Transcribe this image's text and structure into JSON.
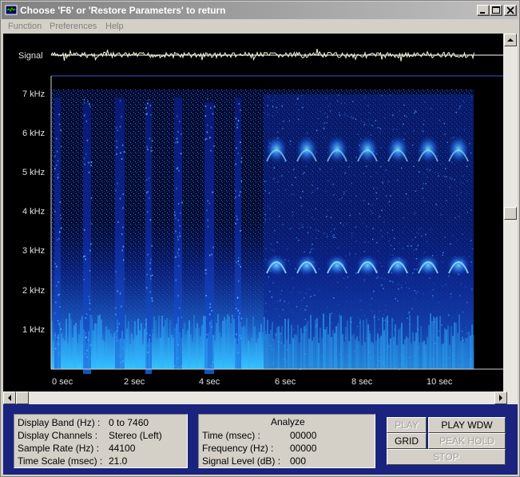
{
  "window": {
    "title": "Choose 'F6' or 'Restore Parameters' to return",
    "minimize_glyph": "_",
    "maximize_glyph": "□",
    "close_glyph": "×"
  },
  "menu": {
    "items": [
      "Function",
      "Preferences",
      "Help"
    ]
  },
  "display": {
    "signal_label": "Signal",
    "freq_labels": [
      "7 kHz",
      "6 kHz",
      "5 kHz",
      "4 kHz",
      "3 kHz",
      "2 kHz",
      "1 kHz"
    ],
    "time_labels": [
      "0  sec",
      "2  sec",
      "4  sec",
      "6  sec",
      "8  sec",
      "10  sec"
    ],
    "colors": {
      "background": "#000000",
      "spectrogram_low": "#0a1a6e",
      "spectrogram_high": "#3fd0ff",
      "waveform": "#f5f5dc"
    }
  },
  "info": {
    "rows": [
      {
        "label": "Display Band (Hz) :",
        "value": "0 to 7460"
      },
      {
        "label": "Display Channels :",
        "value": "Stereo (Left)"
      },
      {
        "label": "Sample Rate (Hz) :",
        "value": "44100"
      },
      {
        "label": "Time Scale (msec) :",
        "value": "21.0"
      }
    ]
  },
  "analyze": {
    "title": "Analyze",
    "rows": [
      {
        "label": "Time (msec) :",
        "value": "00000"
      },
      {
        "label": "Frequency (Hz) :",
        "value": "00000"
      },
      {
        "label": "Signal Level (dB) :",
        "value": "000"
      }
    ]
  },
  "controls": {
    "play": "PLAY",
    "play_wdw": "PLAY WDW",
    "grid": "GRID",
    "peak_hold": "PEAK HOLD",
    "stop": "STOP"
  }
}
